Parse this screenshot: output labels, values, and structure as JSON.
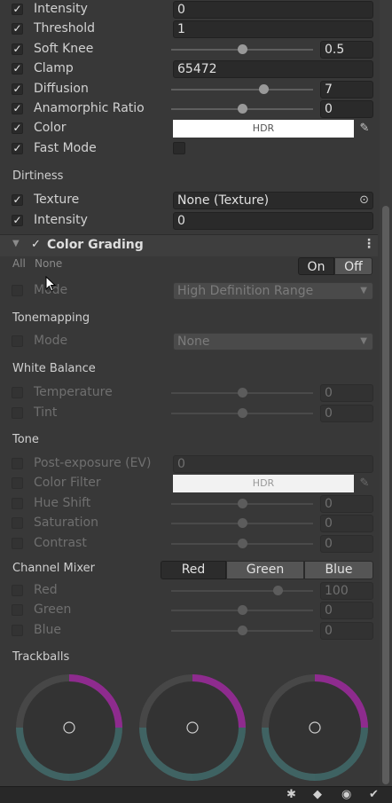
{
  "bloom": {
    "intensity": {
      "label": "Intensity",
      "value": "0"
    },
    "threshold": {
      "label": "Threshold",
      "value": "1"
    },
    "soft_knee": {
      "label": "Soft Knee",
      "value": "0.5",
      "level": 0.5
    },
    "clamp": {
      "label": "Clamp",
      "value": "65472"
    },
    "diffusion": {
      "label": "Diffusion",
      "value": "7",
      "level": 0.65
    },
    "anamorphic_ratio": {
      "label": "Anamorphic Ratio",
      "value": "0",
      "level": 0.5
    },
    "color": {
      "label": "Color",
      "swatch_text": "HDR"
    },
    "fast_mode": {
      "label": "Fast Mode"
    }
  },
  "dirtiness": {
    "section": "Dirtiness",
    "texture": {
      "label": "Texture",
      "value": "None (Texture)"
    },
    "intensity": {
      "label": "Intensity",
      "value": "0"
    }
  },
  "color_grading": {
    "title": "Color Grading",
    "all_label": "All",
    "none_label": "None",
    "on_label": "On",
    "off_label": "Off",
    "mode": {
      "label": "Mode",
      "value": "High Definition Range"
    },
    "tonemapping": {
      "section": "Tonemapping",
      "mode_label": "Mode",
      "mode_value": "None"
    },
    "white_balance": {
      "section": "White Balance",
      "temperature": {
        "label": "Temperature",
        "value": "0",
        "level": 0.5
      },
      "tint": {
        "label": "Tint",
        "value": "0",
        "level": 0.5
      }
    },
    "tone": {
      "section": "Tone",
      "post_exposure": {
        "label": "Post-exposure (EV)",
        "value": "0"
      },
      "color_filter": {
        "label": "Color Filter",
        "swatch_text": "HDR"
      },
      "hue_shift": {
        "label": "Hue Shift",
        "value": "0",
        "level": 0.5
      },
      "saturation": {
        "label": "Saturation",
        "value": "0",
        "level": 0.5
      },
      "contrast": {
        "label": "Contrast",
        "value": "0",
        "level": 0.5
      }
    },
    "channel_mixer": {
      "section": "Channel Mixer",
      "tabs": [
        "Red",
        "Green",
        "Blue"
      ],
      "selected_tab": "Green",
      "red": {
        "label": "Red",
        "value": "100",
        "level": 0.75
      },
      "green": {
        "label": "Green",
        "value": "0",
        "level": 0.5
      },
      "blue": {
        "label": "Blue",
        "value": "0",
        "level": 0.5
      }
    },
    "trackballs": {
      "section": "Trackballs",
      "count": 3
    }
  },
  "colors": {
    "panel_bg": "#383838",
    "field_bg": "#2a2a2a",
    "trackball_purple": "#9a2a9a",
    "trackball_teal": "#3f6c6c",
    "trackball_grey": "#4a4a4a"
  }
}
